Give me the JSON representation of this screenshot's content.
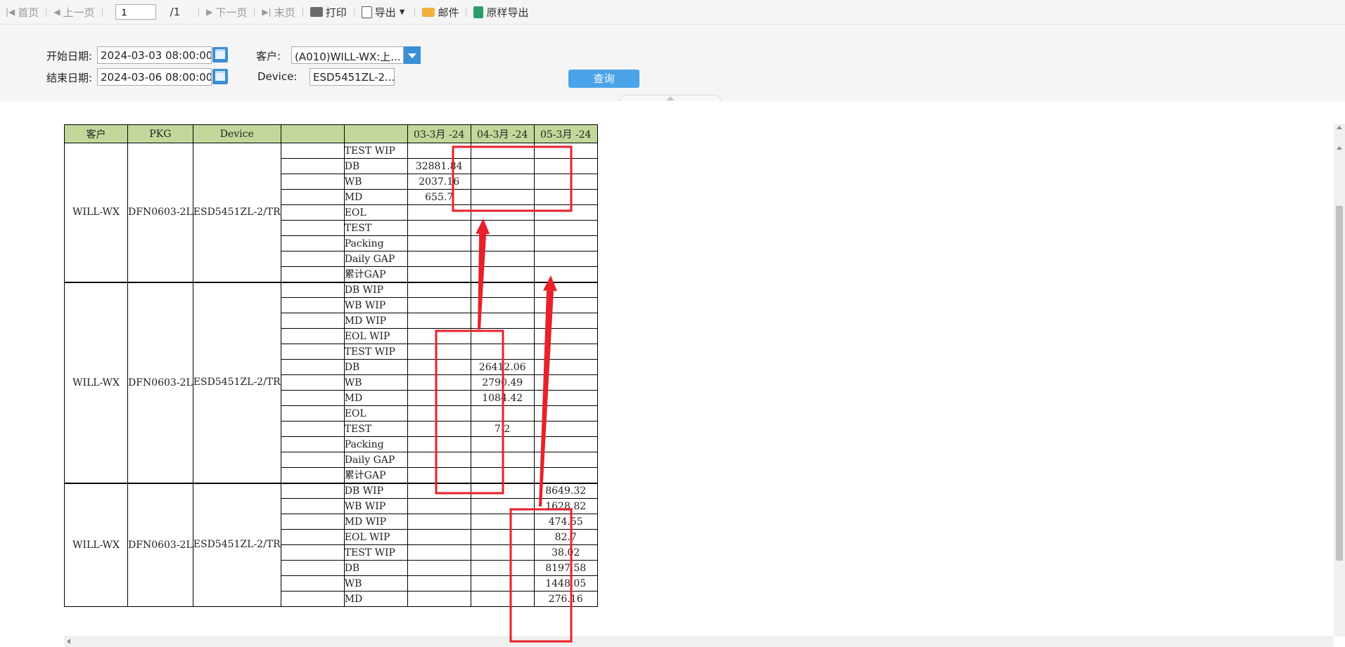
{
  "toolbar": {
    "first": "首页",
    "prev": "上一页",
    "page_value": "1",
    "page_total": "/1",
    "next": "下一页",
    "last": "末页",
    "print": "打印",
    "export": "导出",
    "mail": "邮件",
    "raw_export": "原样导出"
  },
  "filters": {
    "start_label": "开始日期:",
    "start_value": "2024-03-03 08:00:00",
    "end_label": "结束日期:",
    "end_value": "2024-03-06 08:00:00",
    "customer_label": "客户:",
    "customer_value": "(A010)WILL-WX:上...",
    "device_label": "Device:",
    "device_value": "ESD5451ZL-2...",
    "query": "查询"
  },
  "table": {
    "headers": [
      "客户",
      "PKG",
      "Device",
      "",
      "",
      "03-3月 -24",
      "04-3月 -24",
      "05-3月 -24"
    ],
    "groups": [
      {
        "customer": "WILL-WX",
        "pkg": "DFN0603-2L",
        "device": "ESD5451ZL-2/TR",
        "rows": [
          {
            "label": "TEST WIP",
            "v": [
              "",
              "",
              ""
            ]
          },
          {
            "label": "DB",
            "v": [
              "32881.84",
              "",
              ""
            ]
          },
          {
            "label": "WB",
            "v": [
              "2037.16",
              "",
              ""
            ]
          },
          {
            "label": "MD",
            "v": [
              "655.7",
              "",
              ""
            ]
          },
          {
            "label": "EOL",
            "v": [
              "",
              "",
              ""
            ]
          },
          {
            "label": "TEST",
            "v": [
              "",
              "",
              ""
            ]
          },
          {
            "label": "Packing",
            "v": [
              "",
              "",
              ""
            ]
          },
          {
            "label": "Daily GAP",
            "v": [
              "",
              "",
              ""
            ]
          },
          {
            "label": "累计GAP",
            "v": [
              "",
              "",
              ""
            ]
          }
        ]
      },
      {
        "customer": "WILL-WX",
        "pkg": "DFN0603-2L",
        "device": "ESD5451ZL-2/TR",
        "rows": [
          {
            "label": "DB WIP",
            "v": [
              "",
              "",
              ""
            ]
          },
          {
            "label": "WB WIP",
            "v": [
              "",
              "",
              ""
            ]
          },
          {
            "label": "MD WIP",
            "v": [
              "",
              "",
              ""
            ]
          },
          {
            "label": "EOL WIP",
            "v": [
              "",
              "",
              ""
            ]
          },
          {
            "label": "TEST WIP",
            "v": [
              "",
              "",
              ""
            ]
          },
          {
            "label": "DB",
            "v": [
              "",
              "26412.06",
              ""
            ]
          },
          {
            "label": "WB",
            "v": [
              "",
              "2790.49",
              ""
            ]
          },
          {
            "label": "MD",
            "v": [
              "",
              "1084.42",
              ""
            ]
          },
          {
            "label": "EOL",
            "v": [
              "",
              "",
              ""
            ]
          },
          {
            "label": "TEST",
            "v": [
              "",
              "7.2",
              ""
            ]
          },
          {
            "label": "Packing",
            "v": [
              "",
              "",
              ""
            ]
          },
          {
            "label": "Daily GAP",
            "v": [
              "",
              "",
              ""
            ]
          },
          {
            "label": "累计GAP",
            "v": [
              "",
              "",
              ""
            ]
          }
        ]
      },
      {
        "customer": "WILL-WX",
        "pkg": "DFN0603-2L",
        "device": "ESD5451ZL-2/TR",
        "rows": [
          {
            "label": "DB WIP",
            "v": [
              "",
              "",
              "8649.32"
            ]
          },
          {
            "label": "WB WIP",
            "v": [
              "",
              "",
              "1628.82"
            ]
          },
          {
            "label": "MD WIP",
            "v": [
              "",
              "",
              "474.55"
            ]
          },
          {
            "label": "EOL WIP",
            "v": [
              "",
              "",
              "82.7"
            ]
          },
          {
            "label": "TEST WIP",
            "v": [
              "",
              "",
              "38.02"
            ]
          },
          {
            "label": "DB",
            "v": [
              "",
              "",
              "8197.58"
            ]
          },
          {
            "label": "WB",
            "v": [
              "",
              "",
              "1448.05"
            ]
          },
          {
            "label": "MD",
            "v": [
              "",
              "",
              "276.16"
            ]
          }
        ]
      }
    ]
  },
  "annotation_color": "#e8202a"
}
